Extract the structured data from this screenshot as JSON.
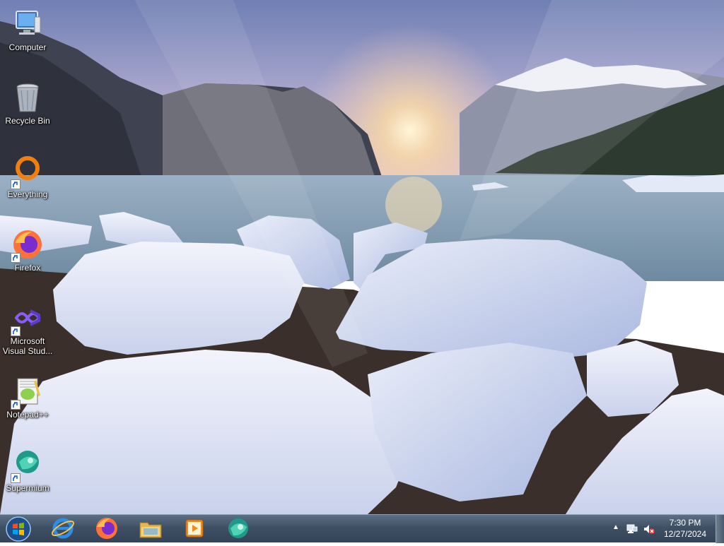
{
  "desktop": {
    "icons": [
      {
        "label": "Computer",
        "icon": "computer-icon"
      },
      {
        "label": "Recycle Bin",
        "icon": "recycle-bin-icon"
      },
      {
        "label": "Everything",
        "icon": "everything-icon"
      },
      {
        "label": "Firefox",
        "icon": "firefox-icon"
      },
      {
        "label": "Microsoft Visual Stud...",
        "label_line1": "Microsoft",
        "label_line2": "Visual Stud...",
        "icon": "visual-studio-icon"
      },
      {
        "label": "Notepad++",
        "icon": "notepad-plus-plus-icon"
      },
      {
        "label": "Supermium",
        "icon": "supermium-icon"
      }
    ]
  },
  "taskbar": {
    "start": "start-orb-icon",
    "pinned": [
      "internet-explorer-icon",
      "firefox-icon",
      "file-explorer-icon",
      "media-player-icon",
      "supermium-icon"
    ],
    "tray": {
      "time": "7:30 PM",
      "date": "12/27/2024",
      "icons": [
        "show-hidden-icons-arrow",
        "network-icon",
        "volume-muted-icon"
      ]
    }
  },
  "colors": {
    "taskbar_top": "#5b6f86",
    "taskbar_bottom": "#33435a"
  }
}
